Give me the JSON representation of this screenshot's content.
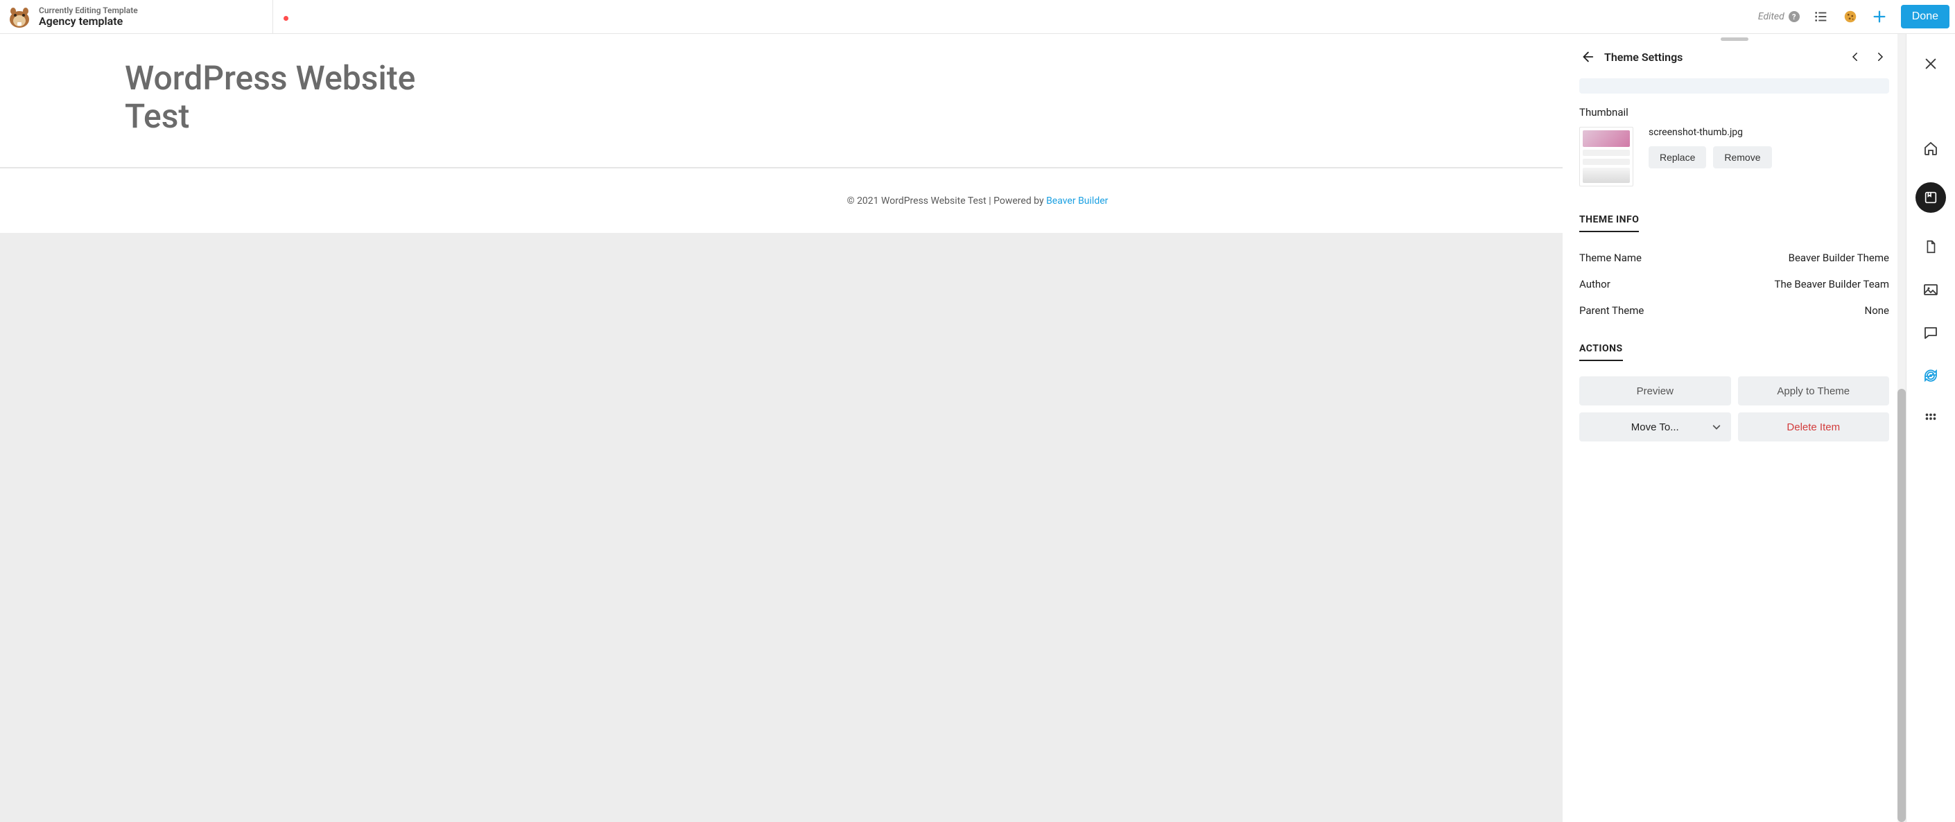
{
  "header": {
    "editing_label": "Currently Editing Template",
    "template_name": "Agency template",
    "status": "Edited",
    "done": "Done"
  },
  "canvas": {
    "site_title": "WordPress Website Test",
    "footer_prefix": "© 2021 WordPress Website Test | Powered by ",
    "footer_link": "Beaver Builder"
  },
  "panel": {
    "title": "Theme Settings",
    "thumbnail_label": "Thumbnail",
    "thumbnail_file": "screenshot-thumb.jpg",
    "replace": "Replace",
    "remove": "Remove",
    "section_info": "THEME INFO",
    "info": {
      "name_label": "Theme Name",
      "name_value": "Beaver Builder Theme",
      "author_label": "Author",
      "author_value": "The Beaver Builder Team",
      "parent_label": "Parent Theme",
      "parent_value": "None"
    },
    "section_actions": "ACTIONS",
    "actions": {
      "preview": "Preview",
      "apply": "Apply to Theme",
      "move": "Move To...",
      "delete": "Delete Item"
    }
  }
}
